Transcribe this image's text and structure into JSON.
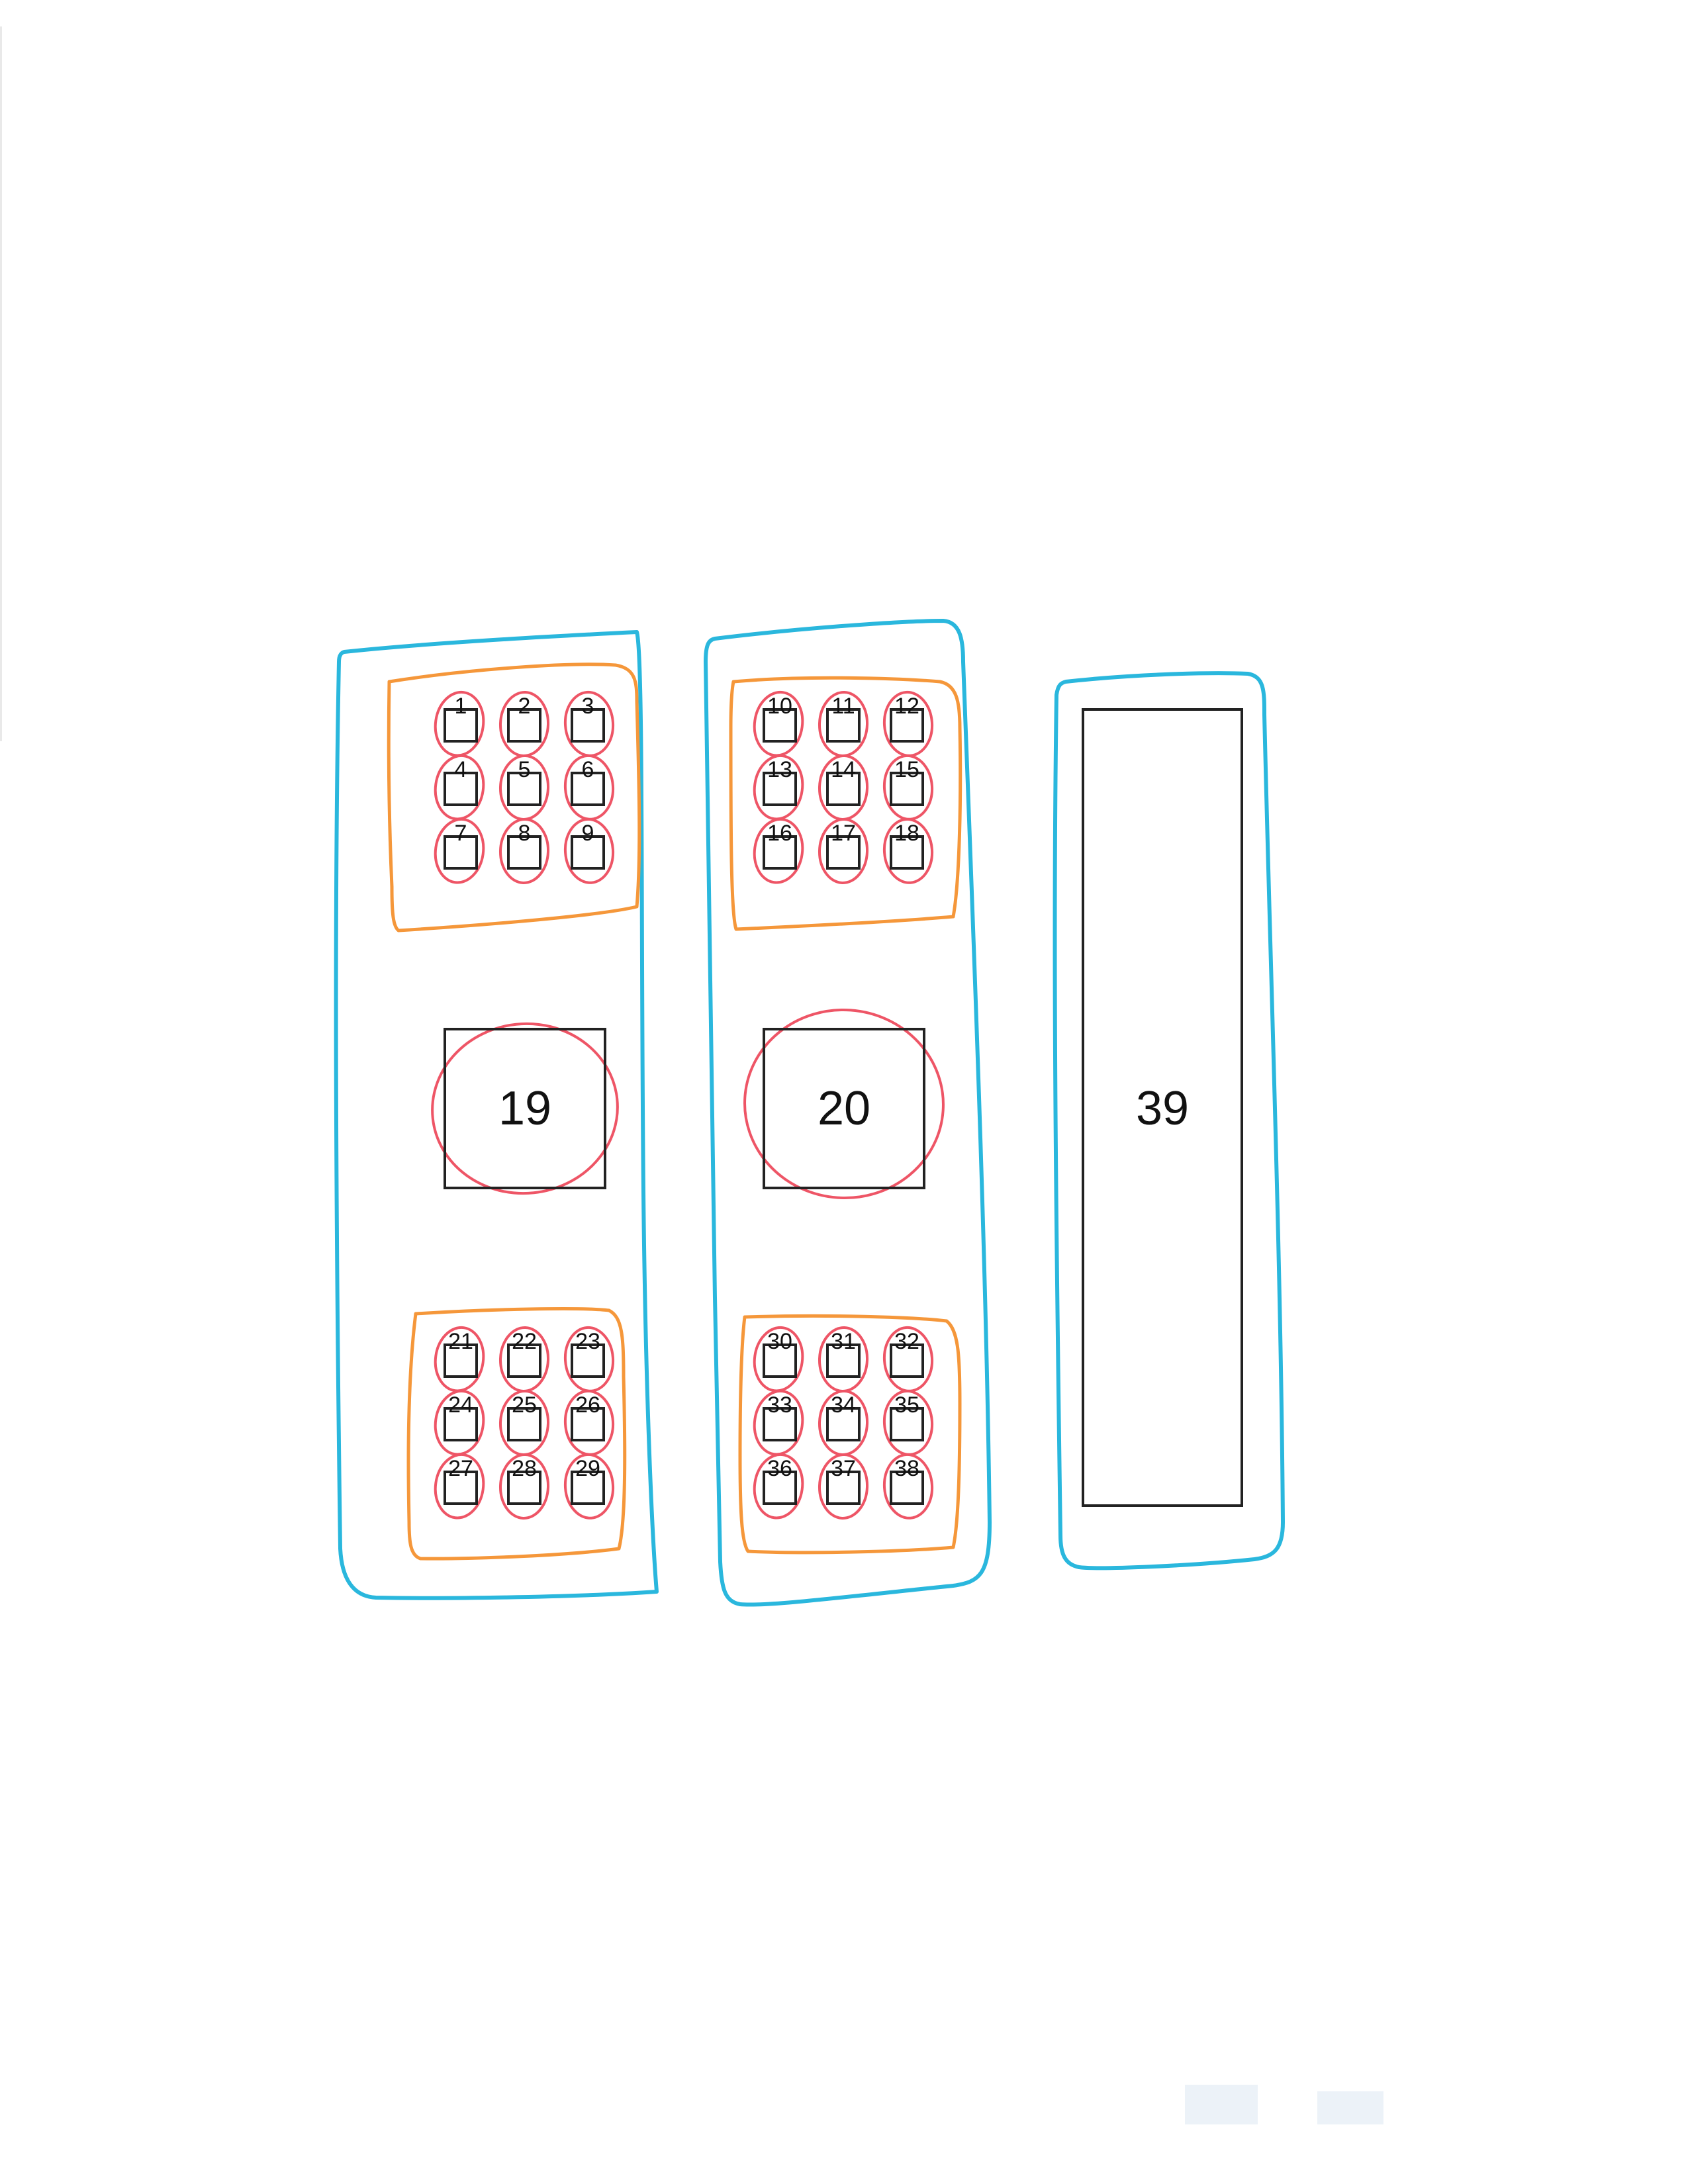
{
  "diagram": {
    "small_boxes": [
      "1",
      "2",
      "3",
      "4",
      "5",
      "6",
      "7",
      "8",
      "9",
      "10",
      "11",
      "12",
      "13",
      "14",
      "15",
      "16",
      "17",
      "18",
      "21",
      "22",
      "23",
      "24",
      "25",
      "26",
      "27",
      "28",
      "29",
      "30",
      "31",
      "32",
      "33",
      "34",
      "35",
      "36",
      "37",
      "38"
    ],
    "large_boxes": [
      "19",
      "20"
    ],
    "tall_box": "39"
  },
  "colors": {
    "group_outline": "#2ab7dd",
    "cluster_outline": "#f5973a",
    "circle_mark": "#ee5566",
    "box_stroke": "#222222"
  }
}
